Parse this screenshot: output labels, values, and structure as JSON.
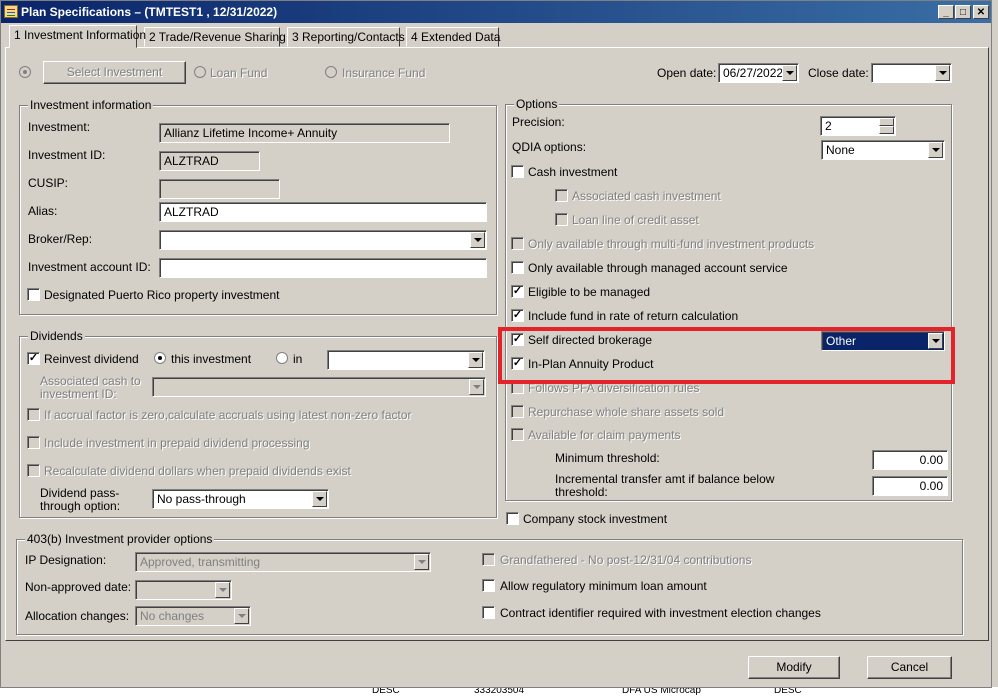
{
  "window": {
    "title": "Plan Specifications – (TMTEST1 , 12/31/2022)",
    "buttons": {
      "minimize": "_",
      "maximize": "□",
      "close": "✕"
    }
  },
  "tabs": [
    {
      "label": "1 Investment Information"
    },
    {
      "label": "2 Trade/Revenue Sharing"
    },
    {
      "label": "3 Reporting/Contacts"
    },
    {
      "label": "4 Extended Data"
    }
  ],
  "top": {
    "select_investment": "Select Investment",
    "loan_fund": "Loan Fund",
    "insurance_fund": "Insurance Fund",
    "open_date_label": "Open date:",
    "open_date_value": "06/27/2022",
    "close_date_label": "Close date:",
    "close_date_value": ""
  },
  "investment_info": {
    "legend": "Investment information",
    "investment_label": "Investment:",
    "investment_value": "Allianz Lifetime Income+ Annuity",
    "investment_id_label": "Investment ID:",
    "investment_id_value": "ALZTRAD",
    "cusip_label": "CUSIP:",
    "cusip_value": "",
    "alias_label": "Alias:",
    "alias_value": "ALZTRAD",
    "broker_label": "Broker/Rep:",
    "broker_value": "",
    "account_id_label": "Investment account ID:",
    "account_id_value": "",
    "puerto_rico_label": "Designated Puerto Rico property investment"
  },
  "dividends": {
    "legend": "Dividends",
    "reinvest_label": "Reinvest dividend",
    "this_investment_label": "this investment",
    "in_label": "in",
    "in_value": "",
    "assoc_cash_label_1": "Associated cash to",
    "assoc_cash_label_2": "investment ID:",
    "accrual_label": "If accrual factor is zero,calculate accruals using latest non-zero factor",
    "prepaid_label": "Include investment in prepaid dividend processing",
    "recalc_label": "Recalculate dividend dollars when prepaid dividends exist",
    "passthrough_label_1": "Dividend pass-",
    "passthrough_label_2": "through option:",
    "passthrough_value": "No pass-through"
  },
  "options": {
    "legend": "Options",
    "precision_label": "Precision:",
    "precision_value": "2",
    "qdia_label": "QDIA options:",
    "qdia_value": "None",
    "cash_investment": "Cash investment",
    "assoc_cash": "Associated cash investment",
    "loan_line": "Loan line of credit asset",
    "multi_fund": "Only available through multi-fund investment products",
    "managed_account": "Only available through managed account service",
    "eligible_managed": "Eligible to be managed",
    "include_ror": "Include fund in rate of return calculation",
    "self_directed": "Self directed brokerage",
    "self_directed_value": "Other",
    "in_plan_annuity": "In-Plan Annuity Product",
    "follows_pfa": "Follows PFA diversification rules",
    "repurchase": "Repurchase whole share assets sold",
    "claim_payments": "Available for claim payments",
    "min_threshold_label": "Minimum threshold:",
    "min_threshold_value": "0.00",
    "incremental_label_1": "Incremental transfer amt if balance below",
    "incremental_label_2": "threshold:",
    "incremental_value": "0.00"
  },
  "company_stock": "Company stock investment",
  "provider": {
    "legend": "403(b) Investment provider options",
    "ip_label": "IP Designation:",
    "ip_value": "Approved, transmitting",
    "non_approved_label": "Non-approved date:",
    "non_approved_value": "",
    "allocation_label": "Allocation changes:",
    "allocation_value": "No changes",
    "grandfathered": "Grandfathered - No post-12/31/04 contributions",
    "allow_min_loan": "Allow regulatory minimum loan amount",
    "contract_id": "Contract identifier required with investment election changes"
  },
  "footer": {
    "modify": "Modify",
    "cancel": "Cancel"
  },
  "background_row": [
    "DESC",
    "333203504",
    "DFA US Microcap",
    "DESC"
  ],
  "colors": {
    "highlight": "#e3222a",
    "titlebar": "#0a246a",
    "face": "#d4d0c8"
  }
}
